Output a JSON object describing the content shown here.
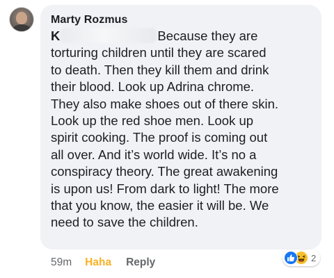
{
  "comment": {
    "author": "Marty Rozmus",
    "mention_initial": "K",
    "lines": [
      "Because they are",
      "torturing children until they are scared",
      "to death. Then they kill them and drink",
      "their blood. Look up Adrina chrome.",
      "They also make shoes out of there skin.",
      "Look up the red shoe men. Look up",
      "spirit cooking. The proof is coming out",
      "all over. And it’s world wide. It’s no a",
      "conspiracy theory. The great awakening",
      "is upon us! From dark to light! The more",
      "that you know, the easier it will be. We",
      "need to save the children."
    ]
  },
  "actions": {
    "timestamp": "59m",
    "haha_label": "Haha",
    "reply_label": "Reply"
  },
  "reactions": {
    "icons": [
      "like-icon",
      "haha-icon"
    ],
    "count": "2"
  },
  "colors": {
    "bubble": "#f0f2f5",
    "text": "#1c1e21",
    "meta": "#65676b",
    "haha": "#f7b125",
    "like": "#1877f2"
  }
}
